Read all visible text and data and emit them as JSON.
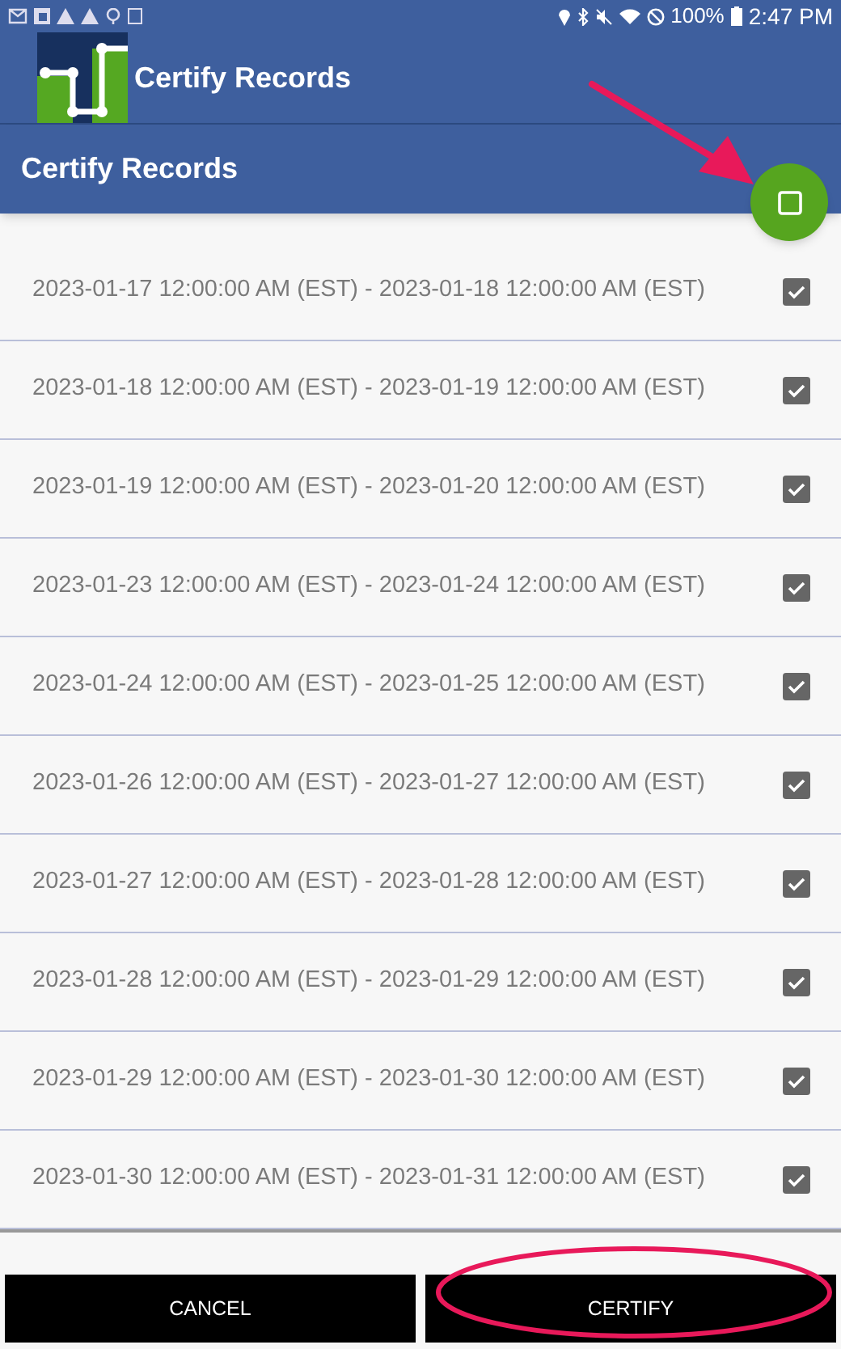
{
  "status_bar": {
    "battery": "100%",
    "time": "2:47 PM"
  },
  "app_bar": {
    "title": "Certify Records"
  },
  "page_header": {
    "title": "Certify Records"
  },
  "records": [
    {
      "label": "2023-01-17 12:00:00 AM (EST) - 2023-01-18 12:00:00 AM (EST)",
      "checked": true
    },
    {
      "label": "2023-01-18 12:00:00 AM (EST) - 2023-01-19 12:00:00 AM (EST)",
      "checked": true
    },
    {
      "label": "2023-01-19 12:00:00 AM (EST) - 2023-01-20 12:00:00 AM (EST)",
      "checked": true
    },
    {
      "label": "2023-01-23 12:00:00 AM (EST) - 2023-01-24 12:00:00 AM (EST)",
      "checked": true
    },
    {
      "label": "2023-01-24 12:00:00 AM (EST) - 2023-01-25 12:00:00 AM (EST)",
      "checked": true
    },
    {
      "label": "2023-01-26 12:00:00 AM (EST) - 2023-01-27 12:00:00 AM (EST)",
      "checked": true
    },
    {
      "label": "2023-01-27 12:00:00 AM (EST) - 2023-01-28 12:00:00 AM (EST)",
      "checked": true
    },
    {
      "label": "2023-01-28 12:00:00 AM (EST) - 2023-01-29 12:00:00 AM (EST)",
      "checked": true
    },
    {
      "label": "2023-01-29 12:00:00 AM (EST) - 2023-01-30 12:00:00 AM (EST)",
      "checked": true
    },
    {
      "label": "2023-01-30 12:00:00 AM (EST) - 2023-01-31 12:00:00 AM (EST)",
      "checked": true
    }
  ],
  "buttons": [
    "CANCEL",
    "CERTIFY"
  ]
}
